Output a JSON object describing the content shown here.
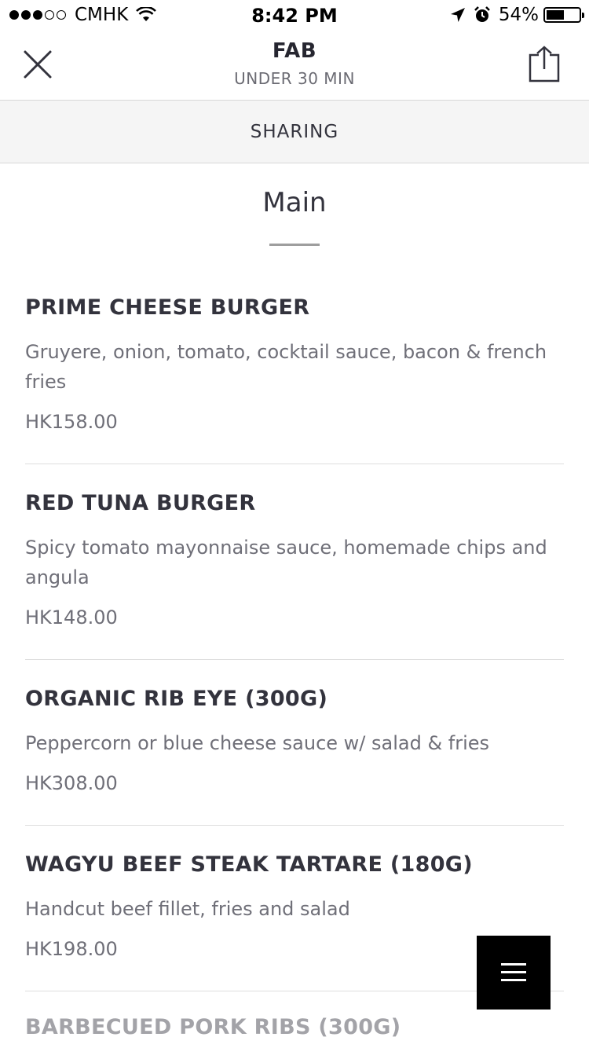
{
  "status_bar": {
    "carrier": "CMHK",
    "signal_filled": 3,
    "signal_total": 5,
    "time": "8:42 PM",
    "battery": "54%",
    "battery_level": 0.54,
    "icons": [
      "wifi-icon",
      "location-arrow-icon",
      "alarm-icon",
      "battery-icon"
    ]
  },
  "nav": {
    "title": "FAB",
    "subtitle": "UNDER 30 MIN",
    "close_icon": "close-icon",
    "share_icon": "share-icon"
  },
  "sharing_label": "SHARING",
  "section": {
    "title": "Main"
  },
  "items": [
    {
      "name": "PRIME CHEESE BURGER",
      "description": "Gruyere, onion, tomato, cocktail sauce, bacon & french fries",
      "price": "HK158.00"
    },
    {
      "name": "RED TUNA BURGER",
      "description": "Spicy tomato mayonnaise sauce, homemade chips and angula",
      "price": "HK148.00"
    },
    {
      "name": "ORGANIC RIB EYE (300G)",
      "description": "Peppercorn or blue cheese sauce w/ salad & fries",
      "price": "HK308.00"
    },
    {
      "name": "WAGYU BEEF STEAK TARTARE (180G)",
      "description": "Handcut beef fillet, fries and salad",
      "price": "HK198.00"
    },
    {
      "name": "BARBECUED PORK RIBS (300G)"
    }
  ],
  "menu_button_icon": "hamburger-menu-icon"
}
